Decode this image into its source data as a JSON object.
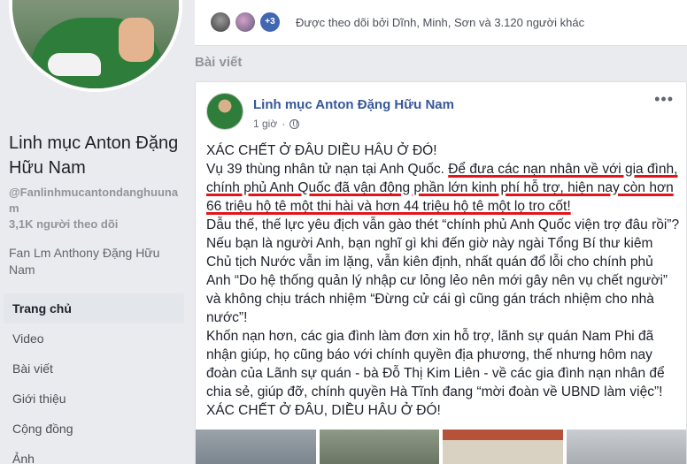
{
  "left": {
    "page_name": "Linh mục Anton Đặng Hữu Nam",
    "handle": "@Fanlinhmucantondanghuunam",
    "followers": "3,1K người theo dõi",
    "description": "Fan Lm Anthony Đặng Hữu Nam",
    "nav": [
      "Trang chủ",
      "Video",
      "Bài viết",
      "Giới thiệu",
      "Cộng đồng",
      "Ảnh"
    ]
  },
  "follow_bar": {
    "more_badge": "+3",
    "text": "Được theo dõi bởi Dĩnh, Minh, Sơn và 3.120 người khác"
  },
  "section_title": "Bài viết",
  "post": {
    "author": "Linh mục Anton Đặng Hữu Nam",
    "time": "1 giờ",
    "more": "•••",
    "p1": "XÁC CHẾT Ở ĐÂU DIỀU HÂU Ở ĐÓ!",
    "p2_a": "Vụ 39 thùng nhân tử nạn tại Anh Quốc. ",
    "p2_b": "Để đưa các nạn nhân về với gia đình, chính phủ Anh Quốc đã vận động phần lớn kinh phí hỗ trợ, hiện nay còn hơn 66 triệu hộ tê một thi hài và hơn 44 triệu hộ tê một lọ tro cốt!",
    "p3": "Dẫu thế, thế lực yêu địch vẫn gào thét “chính phủ Anh Quốc viện trợ đâu rồi”? Nếu bạn là người Anh, bạn nghĩ gì khi đến giờ này ngài Tổng Bí thư kiêm Chủ tịch Nước vẫn im lặng, vẫn kiên định, nhất quán đổ lỗi cho chính phủ Anh “Do hệ thống quản lý nhập cư lỏng lẻo nên mới gây nên vụ chết người” và không chịu trách nhiệm “Đừng cử cái gì cũng gán trách nhiệm cho nhà nước”!",
    "p4": "Khốn nạn hơn, các gia đình làm đơn xin hỗ trợ, lãnh sự quán Nam Phi đã nhận giúp, họ cũng báo với chính quyền địa phương, thế nhưng hôm nay đoàn của Lãnh sự quán - bà Đỗ Thị Kim Liên - về các gia đình nạn nhân để chia sẻ, giúp đỡ, chính quyền Hà Tĩnh đang “mời đoàn về UBND làm việc”!",
    "p5": "XÁC CHẾT Ở ĐÂU, DIỀU HÂU Ở ĐÓ!"
  },
  "colors": {
    "link": "#365899",
    "underline": "#e4141b",
    "accent": "#4267b2"
  }
}
